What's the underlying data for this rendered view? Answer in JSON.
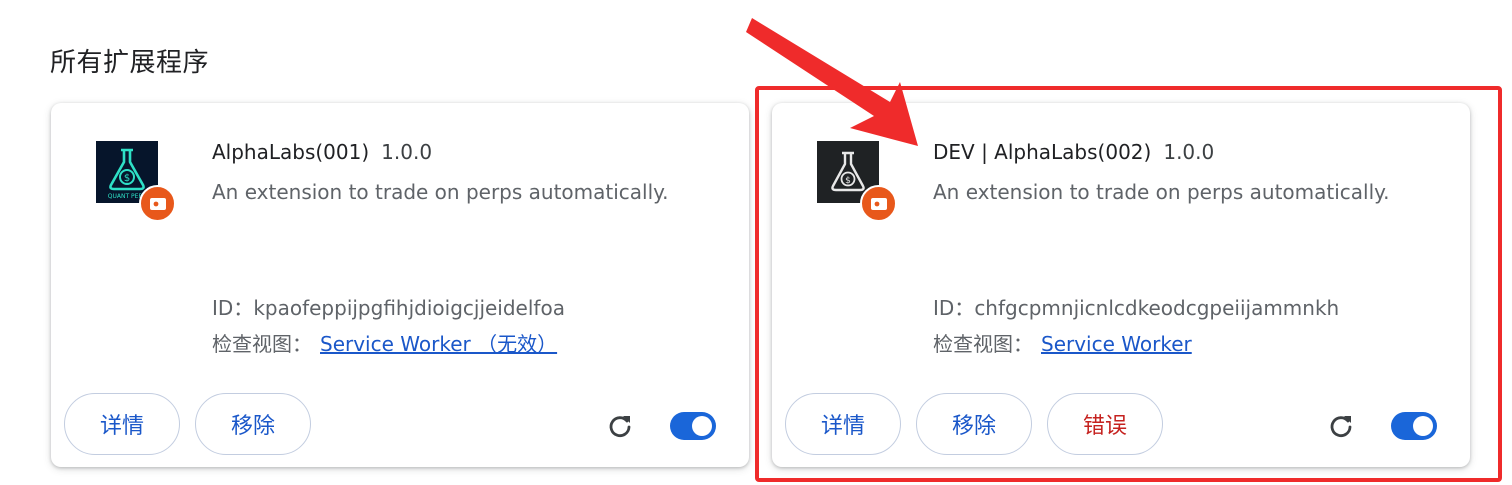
{
  "section_title": "所有扩展程序",
  "extensions": [
    {
      "name": "AlphaLabs(001)",
      "version": "1.0.0",
      "description": "An extension to trade on perps automatically.",
      "id_label": "ID：",
      "id_value": "kpaofeppijpgfihjdioigcjjeidelfoa",
      "inspect_label": "检查视图：",
      "inspect_link": "Service Worker （无效）",
      "icon_text": "QUANT PERP",
      "buttons": {
        "details": "详情",
        "remove": "移除"
      },
      "enabled": true
    },
    {
      "name": "DEV | AlphaLabs(002)",
      "version": "1.0.0",
      "description": "An extension to trade on perps automatically.",
      "id_label": "ID：",
      "id_value": "chfgcpmnjicnlcdkeodcgpeiijammnkh",
      "inspect_label": "检查视图：",
      "inspect_link": "Service Worker",
      "buttons": {
        "details": "详情",
        "remove": "移除",
        "errors": "错误"
      },
      "enabled": true
    }
  ],
  "colors": {
    "link": "#1a57c9",
    "error": "#c5221f",
    "toggle_on": "#1a66d9",
    "badge": "#e8581b",
    "highlight": "#ef2b2b"
  }
}
